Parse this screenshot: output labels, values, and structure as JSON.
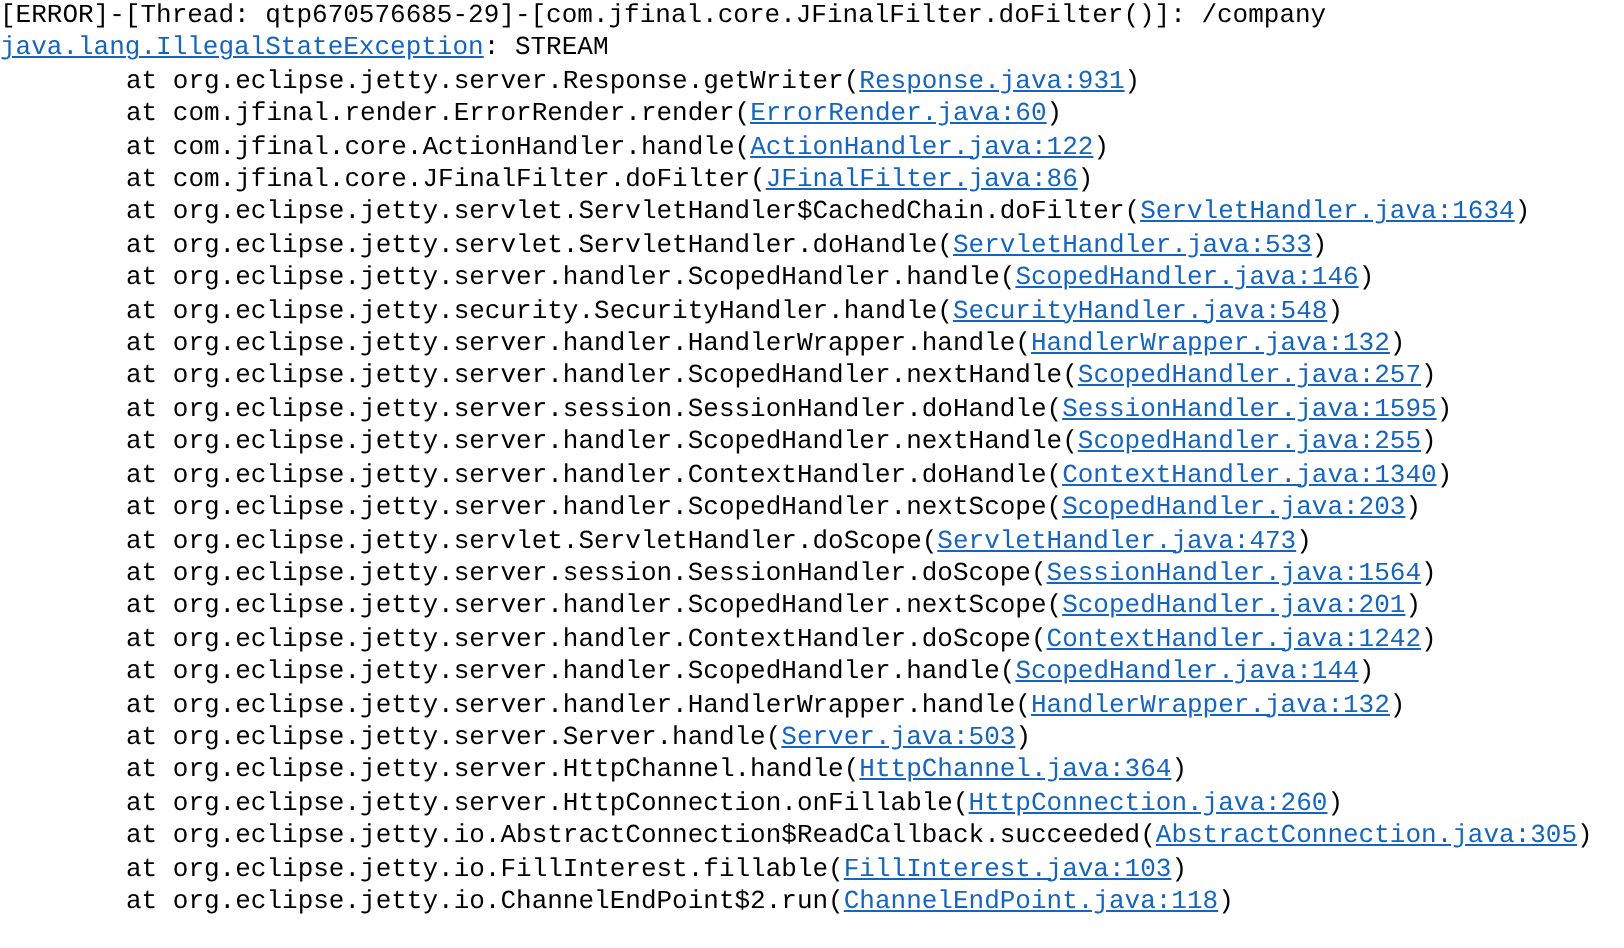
{
  "header": "[ERROR]-[Thread: qtp670576685-29]-[com.jfinal.core.JFinalFilter.doFilter()]: /company",
  "exception": {
    "name": "java.lang.IllegalStateException",
    "message": ": STREAM"
  },
  "frames": [
    {
      "call": "at org.eclipse.jetty.server.Response.getWriter(",
      "source": "Response.java:931",
      "close": ")"
    },
    {
      "call": "at com.jfinal.render.ErrorRender.render(",
      "source": "ErrorRender.java:60",
      "close": ")"
    },
    {
      "call": "at com.jfinal.core.ActionHandler.handle(",
      "source": "ActionHandler.java:122",
      "close": ")"
    },
    {
      "call": "at com.jfinal.core.JFinalFilter.doFilter(",
      "source": "JFinalFilter.java:86",
      "close": ")"
    },
    {
      "call": "at org.eclipse.jetty.servlet.ServletHandler$CachedChain.doFilter(",
      "source": "ServletHandler.java:1634",
      "close": ")"
    },
    {
      "call": "at org.eclipse.jetty.servlet.ServletHandler.doHandle(",
      "source": "ServletHandler.java:533",
      "close": ")"
    },
    {
      "call": "at org.eclipse.jetty.server.handler.ScopedHandler.handle(",
      "source": "ScopedHandler.java:146",
      "close": ")"
    },
    {
      "call": "at org.eclipse.jetty.security.SecurityHandler.handle(",
      "source": "SecurityHandler.java:548",
      "close": ")"
    },
    {
      "call": "at org.eclipse.jetty.server.handler.HandlerWrapper.handle(",
      "source": "HandlerWrapper.java:132",
      "close": ")"
    },
    {
      "call": "at org.eclipse.jetty.server.handler.ScopedHandler.nextHandle(",
      "source": "ScopedHandler.java:257",
      "close": ")"
    },
    {
      "call": "at org.eclipse.jetty.server.session.SessionHandler.doHandle(",
      "source": "SessionHandler.java:1595",
      "close": ")"
    },
    {
      "call": "at org.eclipse.jetty.server.handler.ScopedHandler.nextHandle(",
      "source": "ScopedHandler.java:255",
      "close": ")"
    },
    {
      "call": "at org.eclipse.jetty.server.handler.ContextHandler.doHandle(",
      "source": "ContextHandler.java:1340",
      "close": ")"
    },
    {
      "call": "at org.eclipse.jetty.server.handler.ScopedHandler.nextScope(",
      "source": "ScopedHandler.java:203",
      "close": ")"
    },
    {
      "call": "at org.eclipse.jetty.servlet.ServletHandler.doScope(",
      "source": "ServletHandler.java:473",
      "close": ")"
    },
    {
      "call": "at org.eclipse.jetty.server.session.SessionHandler.doScope(",
      "source": "SessionHandler.java:1564",
      "close": ")"
    },
    {
      "call": "at org.eclipse.jetty.server.handler.ScopedHandler.nextScope(",
      "source": "ScopedHandler.java:201",
      "close": ")"
    },
    {
      "call": "at org.eclipse.jetty.server.handler.ContextHandler.doScope(",
      "source": "ContextHandler.java:1242",
      "close": ")"
    },
    {
      "call": "at org.eclipse.jetty.server.handler.ScopedHandler.handle(",
      "source": "ScopedHandler.java:144",
      "close": ")"
    },
    {
      "call": "at org.eclipse.jetty.server.handler.HandlerWrapper.handle(",
      "source": "HandlerWrapper.java:132",
      "close": ")"
    },
    {
      "call": "at org.eclipse.jetty.server.Server.handle(",
      "source": "Server.java:503",
      "close": ")"
    },
    {
      "call": "at org.eclipse.jetty.server.HttpChannel.handle(",
      "source": "HttpChannel.java:364",
      "close": ")"
    },
    {
      "call": "at org.eclipse.jetty.server.HttpConnection.onFillable(",
      "source": "HttpConnection.java:260",
      "close": ")"
    },
    {
      "call": "at org.eclipse.jetty.io.AbstractConnection$ReadCallback.succeeded(",
      "source": "AbstractConnection.java:305",
      "close": ")"
    },
    {
      "call": "at org.eclipse.jetty.io.FillInterest.fillable(",
      "source": "FillInterest.java:103",
      "close": ")"
    },
    {
      "call": "at org.eclipse.jetty.io.ChannelEndPoint$2.run(",
      "source": "ChannelEndPoint.java:118",
      "close": ")"
    }
  ]
}
